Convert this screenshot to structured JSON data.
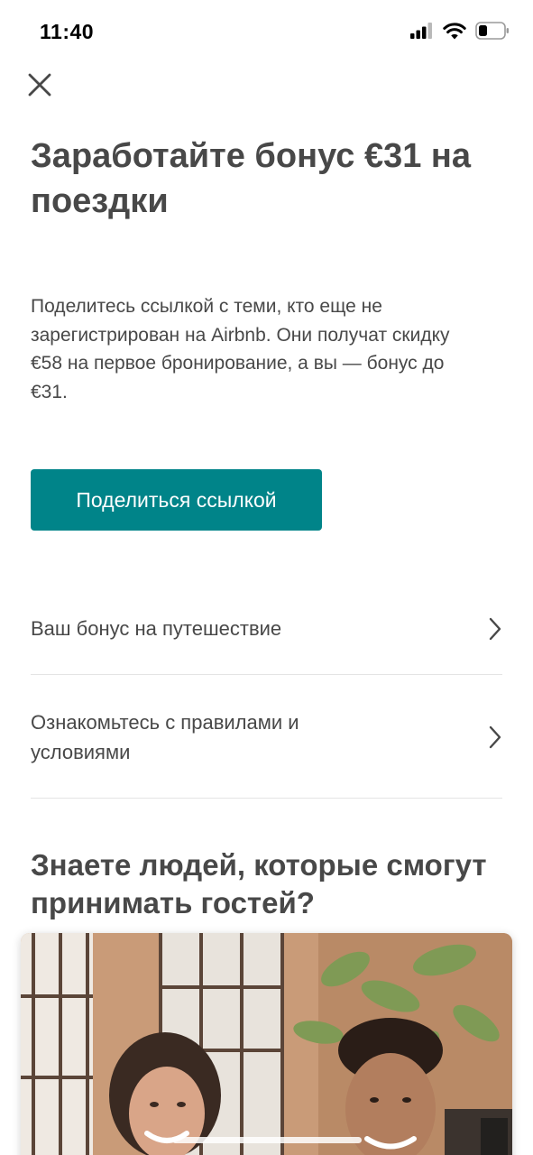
{
  "status_bar": {
    "time": "11:40"
  },
  "header": {
    "close_icon": "close-icon"
  },
  "hero": {
    "title": "Заработайте бонус €31 на поездки",
    "description": "Поделитесь ссылкой с теми, кто еще не зарегистрирован на Airbnb. Они получат скидку €58 на первое бронирование, а вы — бонус до €31."
  },
  "share": {
    "button_label": "Поделиться ссылкой",
    "color": "#008489"
  },
  "links": [
    {
      "label": "Ваш бонус на путешествие",
      "icon": "chevron-right-icon"
    },
    {
      "label": "Ознакомьтесь с правилами и условиями",
      "icon": "chevron-right-icon"
    }
  ],
  "hosts_section": {
    "title": "Знаете людей, которые смогут принимать гостей?"
  }
}
